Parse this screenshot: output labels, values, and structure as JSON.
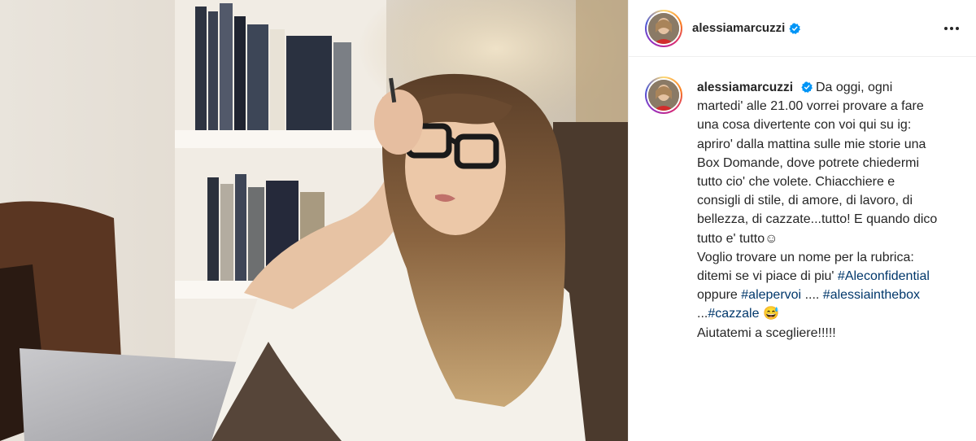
{
  "post": {
    "username": "alessiamarcuzzi",
    "verified": true,
    "more_icon": "more-horizontal-icon",
    "accent_color": "#0095f6",
    "hashtag_color": "#00376b",
    "caption": {
      "lines": [
        "Da oggi, ogni",
        "martedi' alle 21.00 vorrei provare a fare",
        "una cosa divertente con voi qui su ig:",
        "apriro' dalla mattina sulle mie storie una",
        "Box Domande, dove potrete chiedermi",
        "tutto cio' che volete. Chiacchiere e",
        "consigli di stile, di amore, di lavoro, di",
        "bellezza, di cazzate...tutto! E quando dico",
        "tutto e' tutto",
        "Voglio trovare un nome per la rubrica:",
        "ditemi se vi piace di piu'",
        "oppure",
        "....",
        "...",
        "Aiutatemi a scegliere!!!!!"
      ],
      "emoji_1": "☺",
      "emoji_2": "😅",
      "hashtags": [
        "#Aleconfidential",
        "#alepervoi",
        "#alessiainthebox",
        "#cazzale"
      ]
    }
  }
}
